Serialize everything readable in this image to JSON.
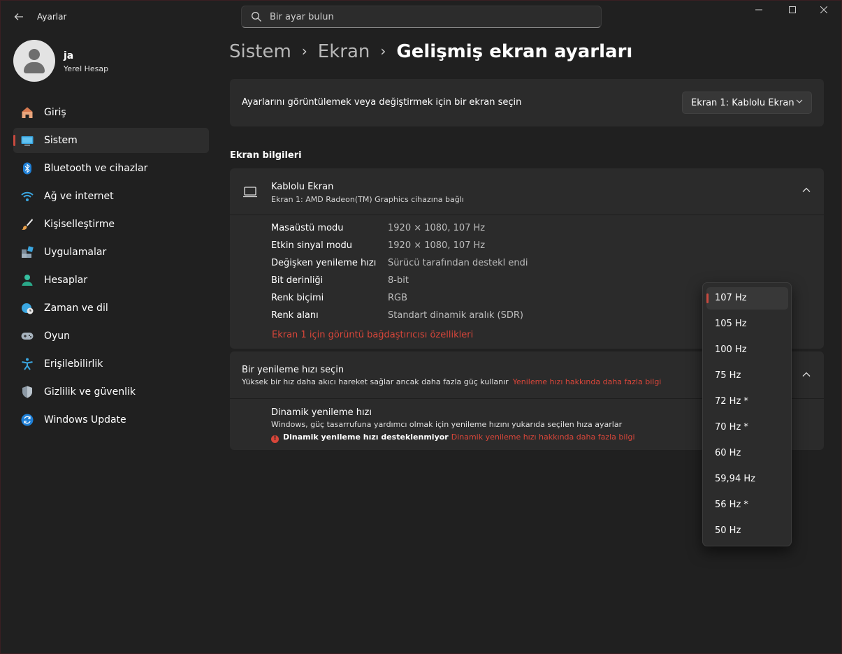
{
  "app": {
    "title": "Ayarlar"
  },
  "search": {
    "placeholder": "Bir ayar bulun"
  },
  "profile": {
    "name": "ja",
    "account_type": "Yerel Hesap"
  },
  "sidebar": {
    "items": [
      {
        "label": "Giriş",
        "icon": "home-icon"
      },
      {
        "label": "Sistem",
        "icon": "monitor-icon",
        "active": true
      },
      {
        "label": "Bluetooth ve cihazlar",
        "icon": "bluetooth-icon"
      },
      {
        "label": "Ağ ve internet",
        "icon": "wifi-icon"
      },
      {
        "label": "Kişiselleştirme",
        "icon": "brush-icon"
      },
      {
        "label": "Uygulamalar",
        "icon": "apps-icon"
      },
      {
        "label": "Hesaplar",
        "icon": "person-icon"
      },
      {
        "label": "Zaman ve dil",
        "icon": "globe-clock-icon"
      },
      {
        "label": "Oyun",
        "icon": "gamepad-icon"
      },
      {
        "label": "Erişilebilirlik",
        "icon": "accessibility-icon"
      },
      {
        "label": "Gizlilik ve güvenlik",
        "icon": "shield-icon"
      },
      {
        "label": "Windows Update",
        "icon": "update-icon"
      }
    ]
  },
  "breadcrumb": {
    "part1": "Sistem",
    "part2": "Ekran",
    "current": "Gelişmiş ekran ayarları"
  },
  "display_select": {
    "label": "Ayarlarını görüntülemek veya değiştirmek için bir ekran seçin",
    "value": "Ekran 1: Kablolu Ekran"
  },
  "display_info": {
    "section_title": "Ekran bilgileri",
    "title": "Kablolu Ekran",
    "subtitle": "Ekran 1: AMD Radeon(TM) Graphics cihazına bağlı",
    "rows": [
      {
        "key": "Masaüstü modu",
        "value": "1920 × 1080, 107 Hz"
      },
      {
        "key": "Etkin sinyal modu",
        "value": "1920 × 1080, 107 Hz"
      },
      {
        "key": "Değişken yenileme hızı",
        "value": "Sürücü tarafından destekl endi"
      },
      {
        "key": "Bit derinliği",
        "value": "8-bit"
      },
      {
        "key": "Renk biçimi",
        "value": "RGB"
      },
      {
        "key": "Renk alanı",
        "value": "Standart dinamik aralık (SDR)"
      }
    ],
    "adapter_link": "Ekran 1 için görüntü bağdaştırıcısı özellikleri"
  },
  "refresh": {
    "title": "Bir yenileme hızı seçin",
    "description": "Yüksek bir hız daha akıcı hareket sağlar ancak daha fazla güç kullanır",
    "link": "Yenileme hızı hakkında daha fazla bilgi",
    "dynamic_title": "Dinamik yenileme hızı",
    "dynamic_desc": "Windows, güç tasarrufuna yardımcı olmak için yenileme hızını yukarıda seçilen hıza ayarlar",
    "dynamic_warning": "Dinamik yenileme hızı desteklenmiyor",
    "dynamic_link": "Dinamik yenileme hızı hakkında daha fazla bilgi"
  },
  "refresh_options": {
    "selected": "107 Hz",
    "items": [
      "107 Hz",
      "105 Hz",
      "100 Hz",
      "75 Hz",
      "72 Hz *",
      "70 Hz *",
      "60 Hz",
      "59,94 Hz",
      "56 Hz *",
      "50 Hz"
    ]
  },
  "colors": {
    "accent": "#c84a3f",
    "link": "#d9463a",
    "background": "#202020",
    "card": "#2b2b2b"
  }
}
